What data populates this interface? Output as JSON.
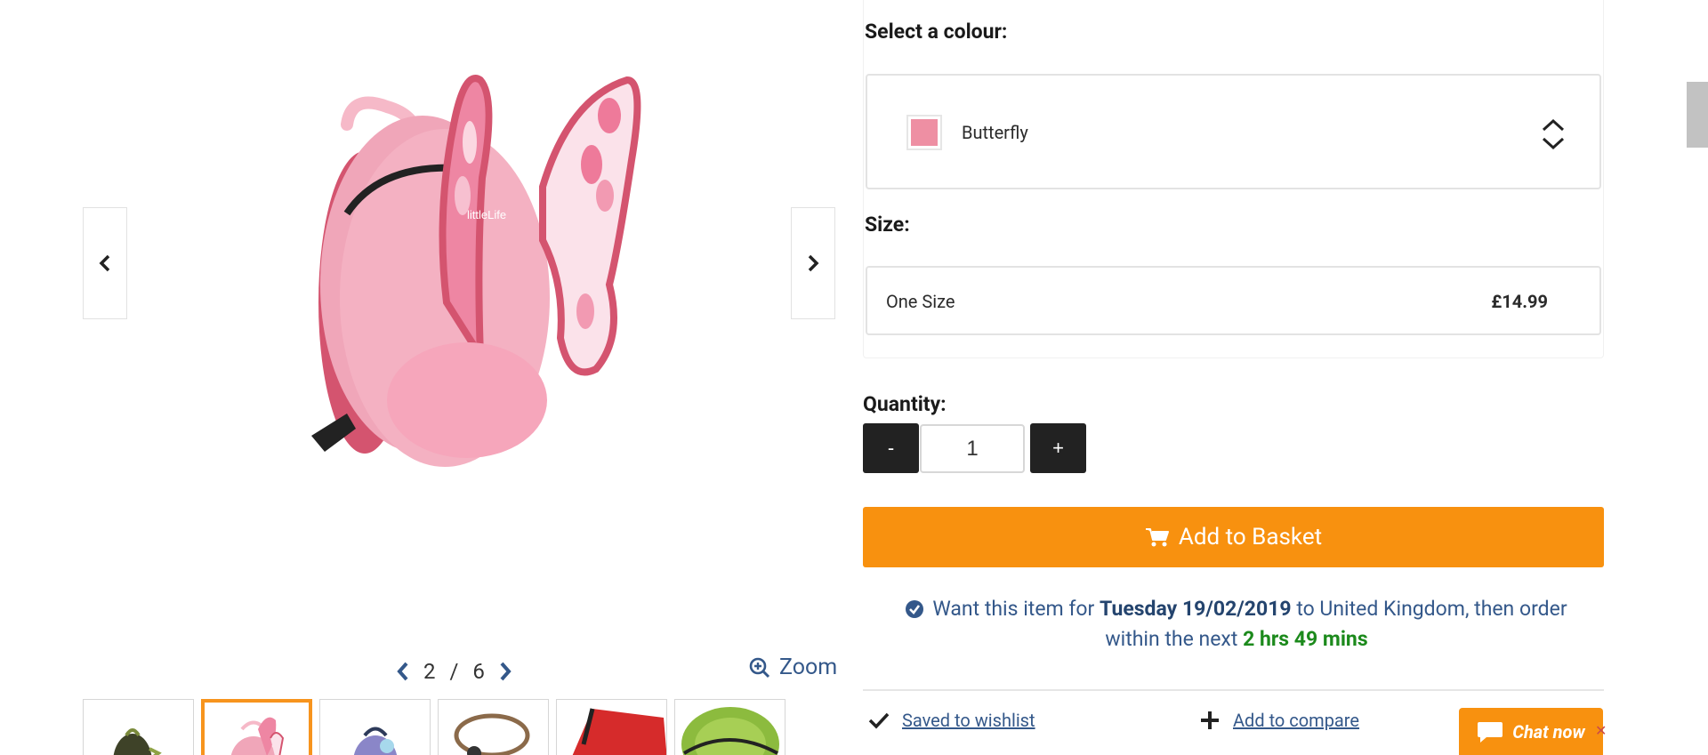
{
  "gallery": {
    "pager_current": "2",
    "pager_separator": "/",
    "pager_total": "6",
    "zoom_label": "Zoom",
    "main_image_brand": "littleLife"
  },
  "options": {
    "colour_label": "Select a colour:",
    "colour_selected": "Butterfly",
    "colour_swatch": "#ee8fa3",
    "size_label": "Size:",
    "size_option": "One Size",
    "size_price": "£14.99"
  },
  "quantity": {
    "label": "Quantity:",
    "minus_label": "-",
    "plus_label": "+",
    "value": "1"
  },
  "basket": {
    "label": "Add to Basket"
  },
  "delivery": {
    "prefix": "Want this item for",
    "date": "Tuesday 19/02/2019",
    "middle": "to United Kingdom, then order within the next",
    "countdown": "2 hrs 49 mins"
  },
  "actions": {
    "wishlist_label": "Saved to wishlist",
    "compare_label": "Add to compare"
  },
  "chat": {
    "label": "Chat now"
  },
  "colors": {
    "accent": "#f8910f",
    "link": "#34588a",
    "success": "#1c8a1c"
  }
}
